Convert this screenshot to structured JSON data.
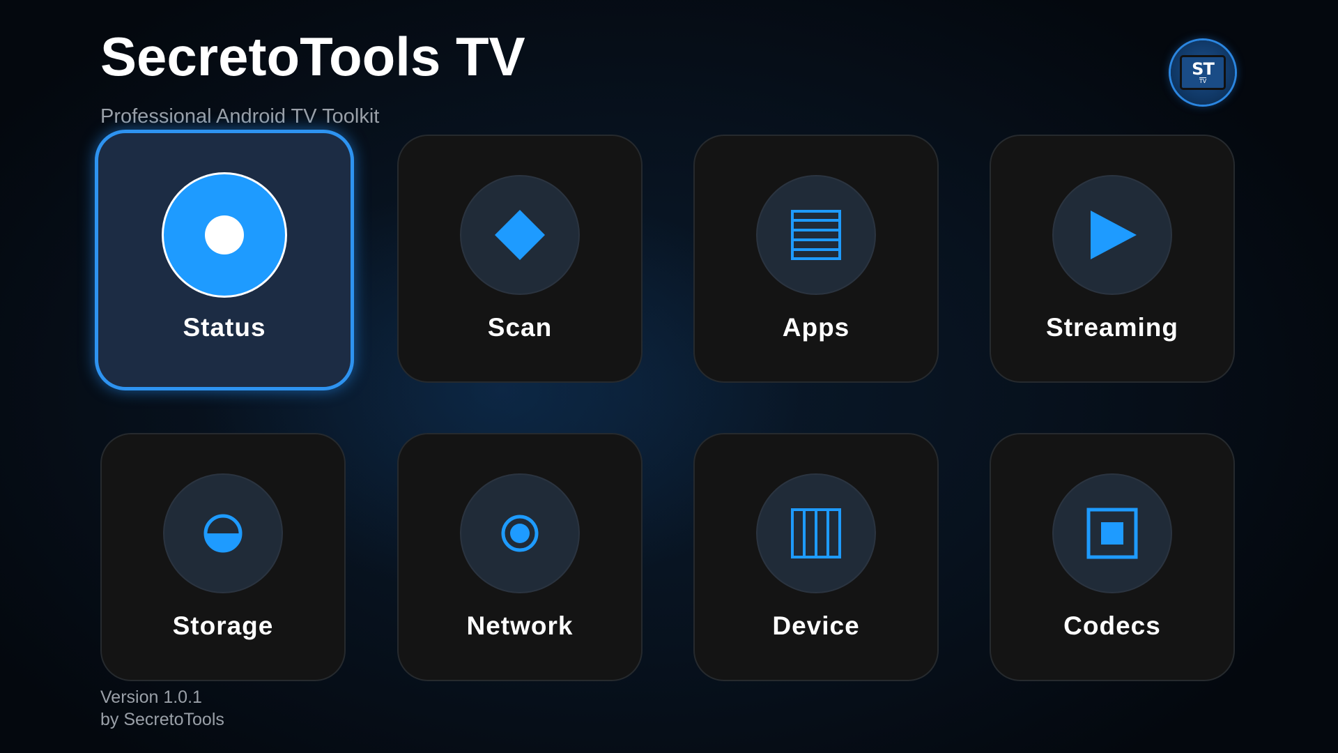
{
  "header": {
    "title": "SecretoTools TV",
    "subtitle": "Professional Android TV Toolkit"
  },
  "logo": {
    "text": "ST",
    "sub": "TV"
  },
  "accent_color": "#1e9bff",
  "tiles": [
    {
      "label": "Status",
      "icon": "status-dot-icon",
      "focused": true
    },
    {
      "label": "Scan",
      "icon": "diamond-icon",
      "focused": false
    },
    {
      "label": "Apps",
      "icon": "list-icon",
      "focused": false
    },
    {
      "label": "Streaming",
      "icon": "play-icon",
      "focused": false
    },
    {
      "label": "Storage",
      "icon": "half-circle-icon",
      "focused": false
    },
    {
      "label": "Network",
      "icon": "radio-target-icon",
      "focused": false
    },
    {
      "label": "Device",
      "icon": "columns-icon",
      "focused": false
    },
    {
      "label": "Codecs",
      "icon": "square-box-icon",
      "focused": false
    }
  ],
  "footer": {
    "version": "Version 1.0.1",
    "author": "by SecretoTools"
  }
}
